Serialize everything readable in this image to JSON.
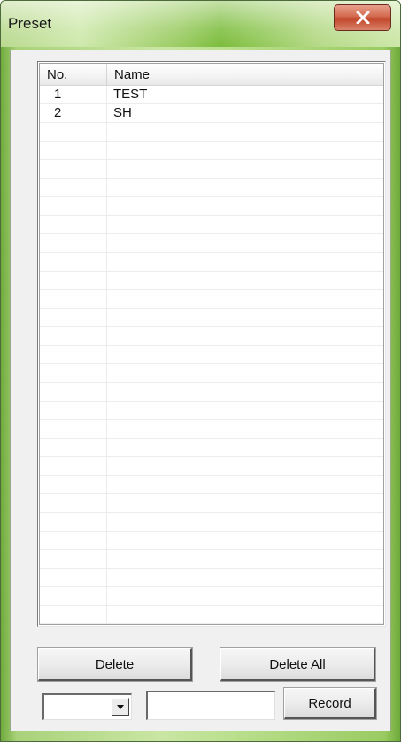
{
  "window": {
    "title": "Preset",
    "close_icon": "close-x-icon",
    "accent_color": "#9acb62",
    "close_color": "#c2462a"
  },
  "list": {
    "columns": [
      "No.",
      "Name"
    ],
    "rows": [
      {
        "no": "1",
        "name": "TEST"
      },
      {
        "no": "2",
        "name": "SH"
      }
    ]
  },
  "buttons": {
    "delete": "Delete",
    "delete_all": "Delete All",
    "record": "Record"
  },
  "combo": {
    "value": "",
    "arrow_icon": "dropdown-arrow-icon"
  },
  "name_input": {
    "value": ""
  }
}
